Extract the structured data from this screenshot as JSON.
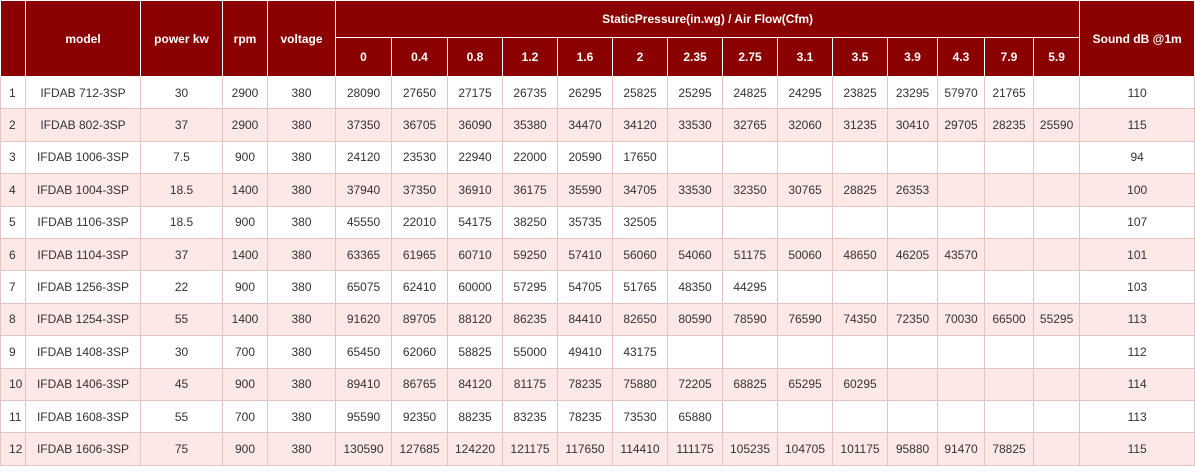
{
  "header": {
    "model": "model",
    "power": "power kw",
    "rpm": "rpm",
    "voltage": "voltage",
    "pressure_group": "StaticPressure(in.wg) / Air Flow(Cfm)",
    "sound": "Sound dB @1m",
    "pressures": [
      "0",
      "0.4",
      "0.8",
      "1.2",
      "1.6",
      "2",
      "2.35",
      "2.75",
      "3.1",
      "3.5",
      "3.9",
      "4.3",
      "7.9",
      "5.9"
    ]
  },
  "rows": [
    {
      "idx": "1",
      "model": "IFDAB 712-3SP",
      "power": "30",
      "rpm": "2900",
      "voltage": "380",
      "flows": [
        "28090",
        "27650",
        "27175",
        "26735",
        "26295",
        "25825",
        "25295",
        "24825",
        "24295",
        "23825",
        "23295",
        "57970",
        "21765",
        ""
      ],
      "sound": "110"
    },
    {
      "idx": "2",
      "model": "IFDAB 802-3SP",
      "power": "37",
      "rpm": "2900",
      "voltage": "380",
      "flows": [
        "37350",
        "36705",
        "36090",
        "35380",
        "34470",
        "34120",
        "33530",
        "32765",
        "32060",
        "31235",
        "30410",
        "29705",
        "28235",
        "25590"
      ],
      "sound": "115"
    },
    {
      "idx": "3",
      "model": "IFDAB 1006-3SP",
      "power": "7.5",
      "rpm": "900",
      "voltage": "380",
      "flows": [
        "24120",
        "23530",
        "22940",
        "22000",
        "20590",
        "17650",
        "",
        "",
        "",
        "",
        "",
        "",
        "",
        ""
      ],
      "sound": "94"
    },
    {
      "idx": "4",
      "model": "IFDAB 1004-3SP",
      "power": "18.5",
      "rpm": "1400",
      "voltage": "380",
      "flows": [
        "37940",
        "37350",
        "36910",
        "36175",
        "35590",
        "34705",
        "33530",
        "32350",
        "30765",
        "28825",
        "26353",
        "",
        "",
        ""
      ],
      "sound": "100"
    },
    {
      "idx": "5",
      "model": "IFDAB 1106-3SP",
      "power": "18.5",
      "rpm": "900",
      "voltage": "380",
      "flows": [
        "45550",
        "22010",
        "54175",
        "38250",
        "35735",
        "32505",
        "",
        "",
        "",
        "",
        "",
        "",
        "",
        ""
      ],
      "sound": "107"
    },
    {
      "idx": "6",
      "model": "IFDAB 1104-3SP",
      "power": "37",
      "rpm": "1400",
      "voltage": "380",
      "flows": [
        "63365",
        "61965",
        "60710",
        "59250",
        "57410",
        "56060",
        "54060",
        "51175",
        "50060",
        "48650",
        "46205",
        "43570",
        "",
        ""
      ],
      "sound": "101"
    },
    {
      "idx": "7",
      "model": "IFDAB 1256-3SP",
      "power": "22",
      "rpm": "900",
      "voltage": "380",
      "flows": [
        "65075",
        "62410",
        "60000",
        "57295",
        "54705",
        "51765",
        "48350",
        "44295",
        "",
        "",
        "",
        "",
        "",
        ""
      ],
      "sound": "103"
    },
    {
      "idx": "8",
      "model": "IFDAB 1254-3SP",
      "power": "55",
      "rpm": "1400",
      "voltage": "380",
      "flows": [
        "91620",
        "89705",
        "88120",
        "86235",
        "84410",
        "82650",
        "80590",
        "78590",
        "76590",
        "74350",
        "72350",
        "70030",
        "66500",
        "55295"
      ],
      "sound": "113"
    },
    {
      "idx": "9",
      "model": "IFDAB 1408-3SP",
      "power": "30",
      "rpm": "700",
      "voltage": "380",
      "flows": [
        "65450",
        "62060",
        "58825",
        "55000",
        "49410",
        "43175",
        "",
        "",
        "",
        "",
        "",
        "",
        "",
        ""
      ],
      "sound": "112"
    },
    {
      "idx": "10",
      "model": "IFDAB 1406-3SP",
      "power": "45",
      "rpm": "900",
      "voltage": "380",
      "flows": [
        "89410",
        "86765",
        "84120",
        "81175",
        "78235",
        "75880",
        "72205",
        "68825",
        "65295",
        "60295",
        "",
        "",
        "",
        ""
      ],
      "sound": "114"
    },
    {
      "idx": "11",
      "model": "IFDAB 1608-3SP",
      "power": "55",
      "rpm": "700",
      "voltage": "380",
      "flows": [
        "95590",
        "92350",
        "88235",
        "83235",
        "78235",
        "73530",
        "65880",
        "",
        "",
        "",
        "",
        "",
        "",
        ""
      ],
      "sound": "113"
    },
    {
      "idx": "12",
      "model": "IFDAB 1606-3SP",
      "power": "75",
      "rpm": "900",
      "voltage": "380",
      "flows": [
        "130590",
        "127685",
        "124220",
        "121175",
        "117650",
        "114410",
        "111175",
        "105235",
        "104705",
        "101175",
        "95880",
        "91470",
        "78825",
        ""
      ],
      "sound": "115"
    }
  ]
}
